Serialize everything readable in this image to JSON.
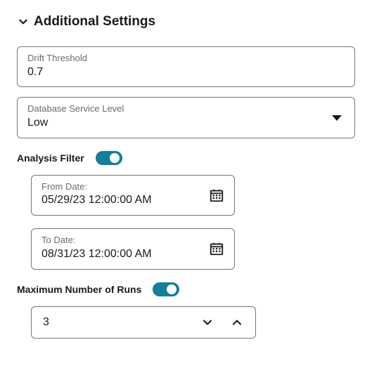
{
  "section": {
    "title": "Additional Settings"
  },
  "driftThreshold": {
    "label": "Drift Threshold",
    "value": "0.7"
  },
  "dbServiceLevel": {
    "label": "Database Service Level",
    "value": "Low"
  },
  "analysisFilter": {
    "label": "Analysis Filter",
    "on": true
  },
  "fromDate": {
    "label": "From Date:",
    "value": "05/29/23 12:00:00 AM"
  },
  "toDate": {
    "label": "To Date:",
    "value": "08/31/23 12:00:00 AM"
  },
  "maxRuns": {
    "label": "Maximum Number of Runs",
    "on": true,
    "value": "3"
  }
}
